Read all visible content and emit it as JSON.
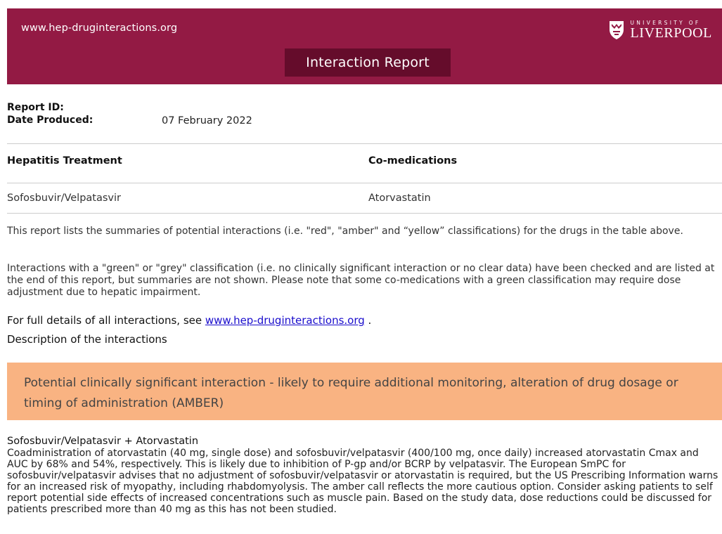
{
  "header": {
    "url": "www.hep-druginteractions.org",
    "logo": {
      "line1": "UNIVERSITY OF",
      "line2": "LIVERPOOL"
    },
    "title": "Interaction Report"
  },
  "meta": {
    "report_id_label": "Report ID:",
    "report_id_value": "",
    "date_label": "Date Produced:",
    "date_value": "07 February 2022"
  },
  "table": {
    "headers": [
      "Hepatitis Treatment",
      "Co-medications"
    ],
    "rows": [
      [
        "Sofosbuvir/Velpatasvir",
        "Atorvastatin"
      ]
    ]
  },
  "intro": {
    "para1": "This report lists the summaries of potential interactions (i.e. \"red\", \"amber\" and “yellow” classifications) for the drugs in the table above.",
    "para2": "Interactions with a \"green\" or \"grey\" classification (i.e. no clinically significant interaction or no clear data) have been checked and are listed at the end of this report, but summaries are not shown. Please note that some co-medications with a green classification may require dose adjustment due to hepatic impairment.",
    "full_details_prefix": "For full details of all interactions, see ",
    "full_details_link": "www.hep-druginteractions.org",
    "full_details_suffix": " .",
    "description_heading": "Description of the interactions"
  },
  "amber": {
    "text": "Potential clinically significant interaction - likely to require additional monitoring, alteration of drug dosage or timing of administration (AMBER)",
    "color": "#f9b382"
  },
  "interaction": {
    "title": "Sofosbuvir/Velpatasvir + Atorvastatin",
    "body": "Coadministration of atorvastatin (40 mg, single dose) and sofosbuvir/velpatasvir (400/100 mg, once daily) increased atorvastatin Cmax and AUC by 68% and 54%, respectively. This is likely due to inhibition of P-gp and/or BCRP by velpatasvir. The European SmPC for sofosbuvir/velpatasvir advises that no adjustment of sofosbuvir/velpatasvir or atorvastatin is required, but the US Prescribing Information warns for an increased risk of myopathy, including rhabdomyolysis. The amber call reflects the more cautious option. Consider asking patients to self report potential side effects of increased concentrations such as muscle pain. Based on the study data, dose reductions could be discussed for patients prescribed more than 40 mg as this has not been studied."
  },
  "colors": {
    "header_band": "#931a44",
    "title_box": "#650c2b",
    "link": "#1a0dcc"
  }
}
